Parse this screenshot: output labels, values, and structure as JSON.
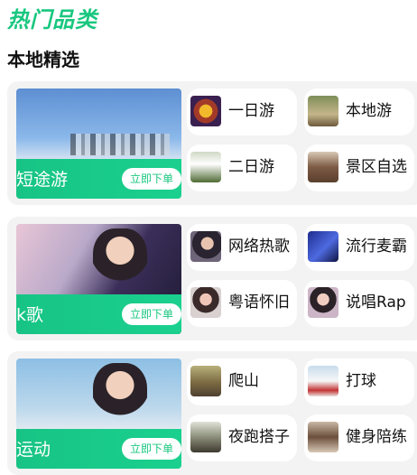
{
  "header": {
    "hot_title": "热门品类",
    "section_title": "本地精选"
  },
  "cards": [
    {
      "feature_label": "短途游",
      "order_label": "立即下单",
      "items": [
        {
          "label": "一日游",
          "icon": "fireworks-photo"
        },
        {
          "label": "本地游",
          "icon": "park-photo"
        },
        {
          "label": "二日游",
          "icon": "pier-photo"
        },
        {
          "label": "景区自选",
          "icon": "scenic-photo"
        }
      ]
    },
    {
      "feature_label": "k歌",
      "order_label": "立即下单",
      "items": [
        {
          "label": "网络热歌",
          "icon": "singer-photo"
        },
        {
          "label": "流行麦霸",
          "icon": "stage-photo"
        },
        {
          "label": "粤语怀旧",
          "icon": "singer-photo"
        },
        {
          "label": "说唱Rap",
          "icon": "singer-photo"
        }
      ]
    },
    {
      "feature_label": "运动",
      "order_label": "立即下单",
      "items": [
        {
          "label": "爬山",
          "icon": "hiking-photo"
        },
        {
          "label": "打球",
          "icon": "ball-photo"
        },
        {
          "label": "夜跑搭子",
          "icon": "running-photo"
        },
        {
          "label": "健身陪练",
          "icon": "gym-photo"
        }
      ]
    }
  ]
}
